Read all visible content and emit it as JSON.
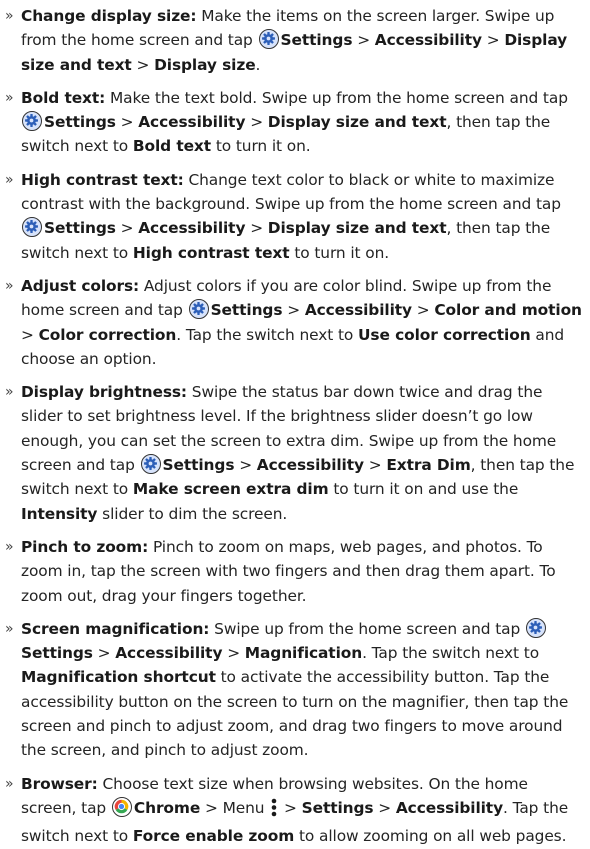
{
  "items": [
    {
      "title": "Change display size:",
      "parts": [
        "Make the items on the screen larger. Swipe up from the home screen and tap",
        {
          "icon": "settings"
        },
        {
          "b": "Settings"
        },
        ">",
        {
          "b": "Accessibility"
        },
        ">",
        {
          "b": "Display size and text"
        },
        ">",
        {
          "b": "Display size"
        },
        "."
      ]
    },
    {
      "title": "Bold text:",
      "parts": [
        "Make the text bold. Swipe up from the home screen and tap",
        {
          "icon": "settings"
        },
        {
          "b": "Settings"
        },
        ">",
        {
          "b": "Accessibility"
        },
        ">",
        {
          "b": "Display size and text"
        },
        ", then tap the switch next to",
        {
          "b": "Bold text"
        },
        "to turn it on."
      ]
    },
    {
      "title": "High contrast text:",
      "parts": [
        "Change text color to black or white to maximize contrast with the background. Swipe up from the home screen and tap",
        {
          "icon": "settings"
        },
        {
          "b": "Settings"
        },
        ">",
        {
          "b": "Accessibility"
        },
        ">",
        {
          "b": "Display size and text"
        },
        ", then tap the switch next to",
        {
          "b": "High contrast text"
        },
        "to turn it on."
      ]
    },
    {
      "title": "Adjust colors:",
      "parts": [
        "Adjust colors if you are color blind. Swipe up from the home screen and tap",
        {
          "icon": "settings"
        },
        {
          "b": "Settings"
        },
        ">",
        {
          "b": "Accessibility"
        },
        ">",
        {
          "b": "Color and motion"
        },
        ">",
        {
          "b": "Color correction"
        },
        ". Tap the switch next to",
        {
          "b": "Use color correction"
        },
        "and choose an option."
      ]
    },
    {
      "title": "Display brightness:",
      "parts": [
        "Swipe the status bar down twice and drag the slider to set brightness level. If the brightness slider doesn’t go low enough, you can set the screen to extra dim. Swipe up from the home screen and tap",
        {
          "icon": "settings"
        },
        {
          "b": "Settings"
        },
        ">",
        {
          "b": "Accessibility"
        },
        ">",
        {
          "b": "Extra Dim"
        },
        ", then tap the switch next to",
        {
          "b": "Make screen extra dim"
        },
        "to turn it on and use the",
        {
          "b": "Intensity"
        },
        "slider to dim the screen."
      ]
    },
    {
      "title": "Pinch to zoom:",
      "parts": [
        "Pinch to zoom on maps, web pages, and photos. To zoom in, tap the screen with two fingers and then drag them apart. To zoom out, drag your fingers together."
      ]
    },
    {
      "title": "Screen magnification:",
      "parts": [
        "Swipe up from the home screen and tap",
        {
          "icon": "settings"
        },
        {
          "b": "Settings"
        },
        ">",
        {
          "b": "Accessibility"
        },
        ">",
        {
          "b": "Magnification"
        },
        ". Tap the switch next to",
        {
          "b": "Magnification shortcut"
        },
        "to activate the accessibility button. Tap the accessibility button on the screen to turn on the magnifier, then tap the screen and pinch to adjust zoom, and drag two fingers to move around the screen, and pinch to adjust zoom."
      ]
    },
    {
      "title": "Browser:",
      "parts": [
        "Choose text size when browsing websites. On the home screen, tap",
        {
          "icon": "chrome"
        },
        {
          "b": "Chrome"
        },
        "> Menu",
        {
          "icon": "menu"
        },
        ">",
        {
          "b": "Settings"
        },
        ">",
        {
          "b": "Accessibility"
        },
        ". Tap the switch next to",
        {
          "b": "Force enable zoom"
        },
        "to allow zooming on all web pages."
      ]
    }
  ],
  "colors": {
    "settings_icon_bg": "#d7e3fb",
    "settings_icon_fg": "#2d5fb8",
    "chrome_red": "#e8453c",
    "chrome_yellow": "#f4b400",
    "chrome_green": "#34a853",
    "chrome_blue": "#4285f4"
  }
}
